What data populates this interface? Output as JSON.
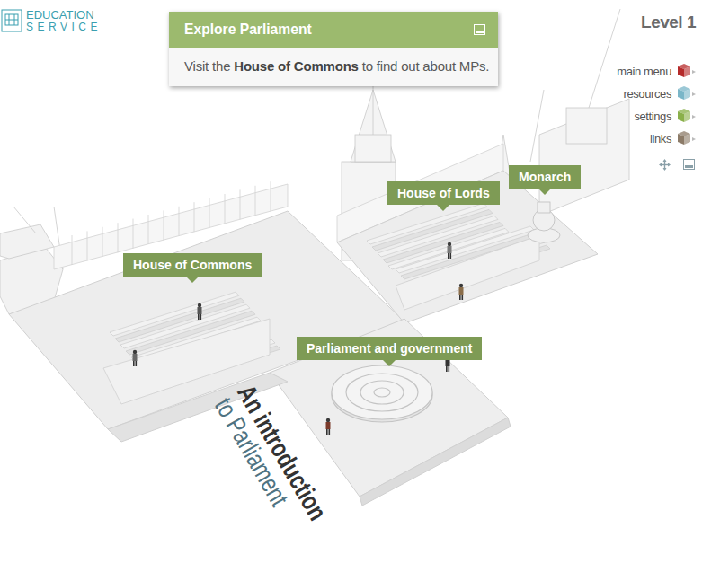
{
  "logo": {
    "line1": "EDUCATION",
    "line2": "SERVICE"
  },
  "popup": {
    "title": "Explore Parliament",
    "text_before": "Visit the ",
    "text_bold": "House of Commons",
    "text_after": " to find out about MPs."
  },
  "level": "Level 1",
  "menu": [
    {
      "label": "main menu",
      "color": "#b52a2a"
    },
    {
      "label": "resources",
      "color": "#7ab6c8"
    },
    {
      "label": "settings",
      "color": "#8ab04a"
    },
    {
      "label": "links",
      "color": "#8c7b68"
    }
  ],
  "map_labels": [
    {
      "label": "House of Commons"
    },
    {
      "label": "House of Lords"
    },
    {
      "label": "Monarch"
    },
    {
      "label": "Parliament and government"
    }
  ],
  "title": {
    "line1": "An introduction",
    "line2": "to Parliament"
  }
}
